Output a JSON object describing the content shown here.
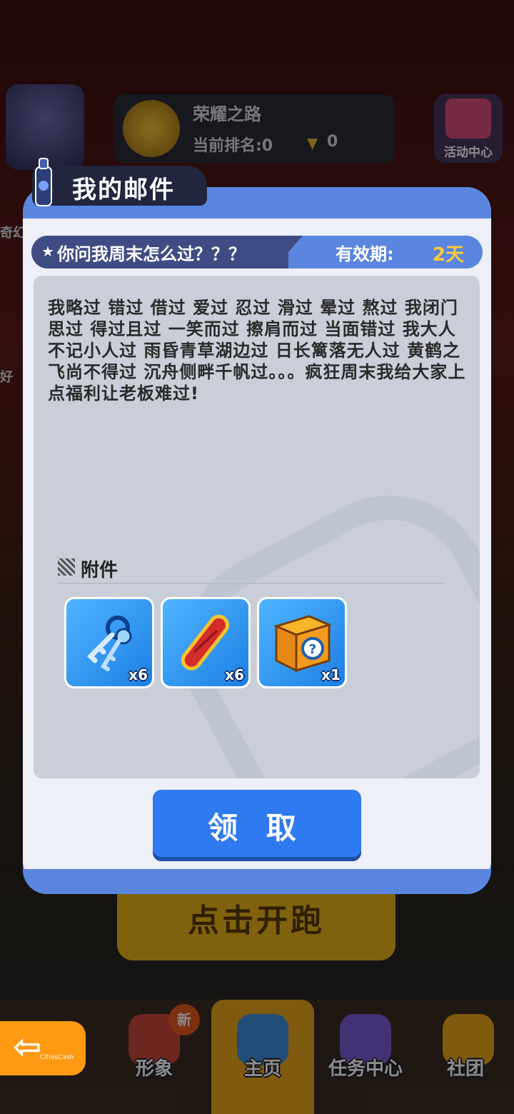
{
  "background": {
    "left_labels": [
      "奇幻",
      "好"
    ],
    "rank_panel": {
      "title": "荣耀之路",
      "rank_text": "当前排名:0",
      "trophy_count": "0"
    },
    "event_button": {
      "label": "活动中心"
    },
    "start_button": {
      "label": "点击开跑"
    }
  },
  "mail": {
    "title": "我的邮件",
    "subject": "你问我周末怎么过？？？",
    "validity_label": "有效期:",
    "validity_value": "2天",
    "body": "我略过 错过 借过 爱过 忍过 滑过 晕过 熬过 我闭门思过 得过且过 一笑而过 擦肩而过 当面错过 我大人不记小人过 雨昏青草湖边过 日长篱落无人过 黄鹤之飞尚不得过 沉舟侧畔千帆过。。。疯狂周末我给大家上点福利让老板难过!",
    "attachments_label": "附件",
    "attachments": [
      {
        "icon": "keys-icon",
        "qty": "x6"
      },
      {
        "icon": "hoverboard-icon",
        "qty": "x6"
      },
      {
        "icon": "mystery-box-icon",
        "qty": "x1"
      }
    ],
    "claim_label": "领 取"
  },
  "nav": {
    "back_tiny": "CitiesCash",
    "new_badge": "新",
    "items": [
      {
        "label": "形象"
      },
      {
        "label": "主页"
      },
      {
        "label": "任务中心"
      },
      {
        "label": "社团"
      }
    ]
  },
  "colors": {
    "dialog_blue": "#5b86df",
    "title_dark": "#21263e",
    "validity_gold": "#ffc93a",
    "claim_blue": "#2f7af0",
    "back_orange": "#ff9a12"
  }
}
